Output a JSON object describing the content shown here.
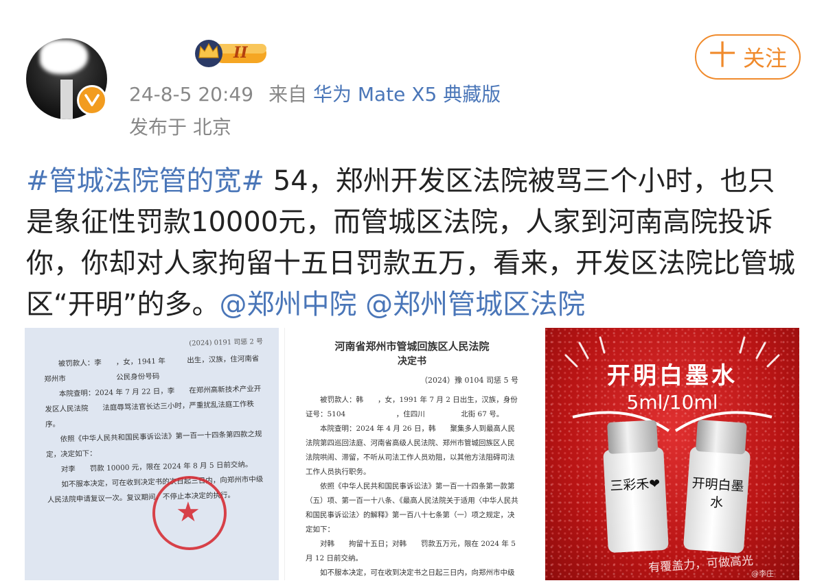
{
  "post": {
    "timestamp": "24-8-5 20:49",
    "source_prefix": "来自",
    "device": "华为 Mate X5 典藏版",
    "location": "发布于 北京",
    "badge_level": "II",
    "follow_label": "关注",
    "follow_plus": "十",
    "hashtag": "#管城法院管的宽#",
    "body": " 54，郑州开发区法院被骂三个小时，也只是象征性罚款10000元，而管城区法院，人家到河南高院投诉你，你却对人家拘留十五日罚款五万，看来，开发区法院比管城区“开明”的多。",
    "mention1": "@郑州中院",
    "mention2": "@郑州管城区法院"
  },
  "images": {
    "doc1": {
      "number": "(2024) 0191 司惩 2 号",
      "p1": "被罚款人：李　　，女，1941 年　　　出生，汉族，住河南省郑州市　　　　　　　公民身份号码",
      "p2": "本院查明：2024 年 7 月 22 日，李　　在郑州高新技术产业开发区人民法院　　法庭辱骂法官长达三小时，严重扰乱法庭工作秩序。",
      "p3": "依照《中华人民共和国民事诉讼法》第一百一十四条第四款之规定，决定如下：",
      "p4": "对李　　罚款 10000 元，限在 2024 年 8 月 5 日前交纳。",
      "p5": "如不服本决定，可在收到决定书的次日起三日内，向郑州市中级人民法院申请复议一次。复议期间，不停止本决定的执行。"
    },
    "doc2": {
      "title": "河南省郑州市管城回族区人民法院",
      "subtitle": "决定书",
      "number": "（2024）豫 0104 司惩 5 号",
      "p1": "被罚款人：韩　　，女，1991 年 7 月 2 日出生，汉族，身份证号：5104　　　　　　　，住四川　　　　　北街 67 号。",
      "p2": "本院查明：2024 年 4 月 26 日，韩　　聚集多人到最高人民法院第四巡回法庭、河南省高级人民法院、郑州市管城回族区人民法院哄闹、滞留，不听从司法工作人员劝阻，以其他方法阻碍司法工作人员执行职务。",
      "p3": "依照《中华人民共和国民事诉讼法》第一百一十四条第一款第（五）项、第一百一十八条、《最高人民法院关于适用〈中华人民共和国民事诉讼法〉的解释》第一百八十七条第（一）项之规定，决定如下：",
      "p4": "对韩　　拘留十五日；对韩　　罚款五万元，限在 2024 年 5 月 12 日前交纳。",
      "p5": "如不服本决定，可在收到决定书之日起三日内，向郑州市中级人民法院申请复议一次。复议期间，不停止本决定的执行。"
    },
    "ink": {
      "title": "开明白墨水",
      "size": "5ml/10ml",
      "bottle1_label": "三彩禾❤",
      "bottle2_label": "开明白墨水",
      "footer": "有覆盖力，可做高光",
      "watermark": "@李庄"
    }
  },
  "colors": {
    "link": "#4a76b8",
    "accent": "#f08a2b",
    "meta": "#888888",
    "seal": "#d6242b"
  }
}
